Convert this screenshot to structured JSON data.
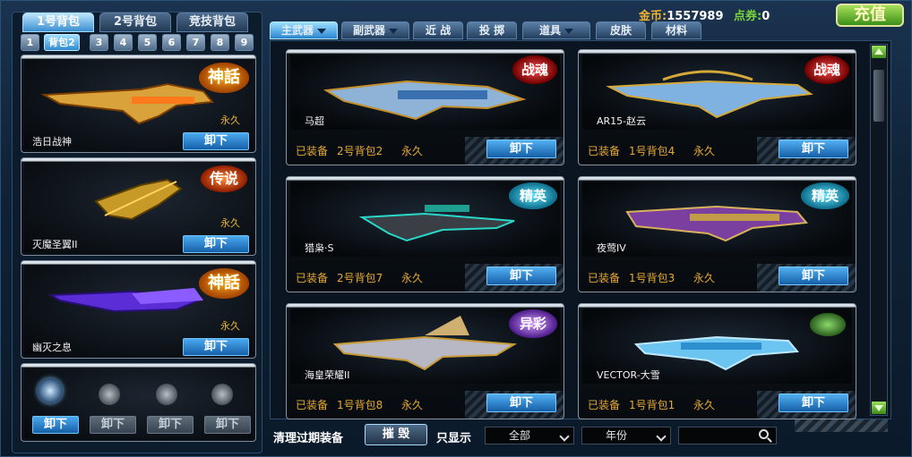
{
  "header": {
    "gold_label": "金币:",
    "gold_value": "1557989",
    "points_label": "点券:",
    "points_value": "0",
    "recharge_label": "充值"
  },
  "bag_tabs": [
    {
      "label": "1号背包",
      "active": true
    },
    {
      "label": "2号背包",
      "active": false
    },
    {
      "label": "竞技背包",
      "active": false
    }
  ],
  "sub_tabs": [
    "1",
    "背包2",
    "3",
    "4",
    "5",
    "6",
    "7",
    "8",
    "9"
  ],
  "equipped": [
    {
      "name": "浩日战神",
      "duration": "永久",
      "badge": "神話",
      "action": "卸下"
    },
    {
      "name": "灭魔圣翼II",
      "duration": "永久",
      "badge": "传说",
      "action": "卸下"
    },
    {
      "name": "幽灭之息",
      "duration": "永久",
      "badge": "神話",
      "action": "卸下"
    }
  ],
  "grenade_slots": [
    {
      "action": "卸下"
    },
    {
      "action": "卸下"
    },
    {
      "action": "卸下"
    },
    {
      "action": "卸下"
    }
  ],
  "weapon_tabs": [
    "主武器",
    "副武器",
    "近 战",
    "投 掷",
    "道具",
    "皮肤",
    "材料"
  ],
  "grid": [
    {
      "name": "马超",
      "status": "已装备",
      "bag": "2号背包2",
      "duration": "永久",
      "badge": "战魂",
      "action": "卸下"
    },
    {
      "name": "AR15-赵云",
      "status": "已装备",
      "bag": "1号背包4",
      "duration": "永久",
      "badge": "战魂",
      "action": "卸下"
    },
    {
      "name": "猎枭·S",
      "status": "已装备",
      "bag": "2号背包7",
      "duration": "永久",
      "badge": "精英",
      "action": "卸下"
    },
    {
      "name": "夜莺IV",
      "status": "已装备",
      "bag": "1号背包3",
      "duration": "永久",
      "badge": "精英",
      "action": "卸下"
    },
    {
      "name": "海皇荣耀II",
      "status": "已装备",
      "bag": "1号背包8",
      "duration": "永久",
      "badge": "异彩",
      "action": "卸下"
    },
    {
      "name": "VECTOR-大雪",
      "status": "已装备",
      "bag": "1号背包1",
      "duration": "永久",
      "badge": "",
      "action": "卸下"
    }
  ],
  "bottom": {
    "clean_label": "清理过期装备",
    "destroy_label": "摧 毁",
    "filter_label": "只显示",
    "select_all": "全部",
    "select_year": "年份"
  },
  "colors": {
    "accent": "#3a8fd0",
    "gold_text": "#f0b030",
    "status_text": "#e5a935",
    "recharge_green": "#5db32a"
  }
}
